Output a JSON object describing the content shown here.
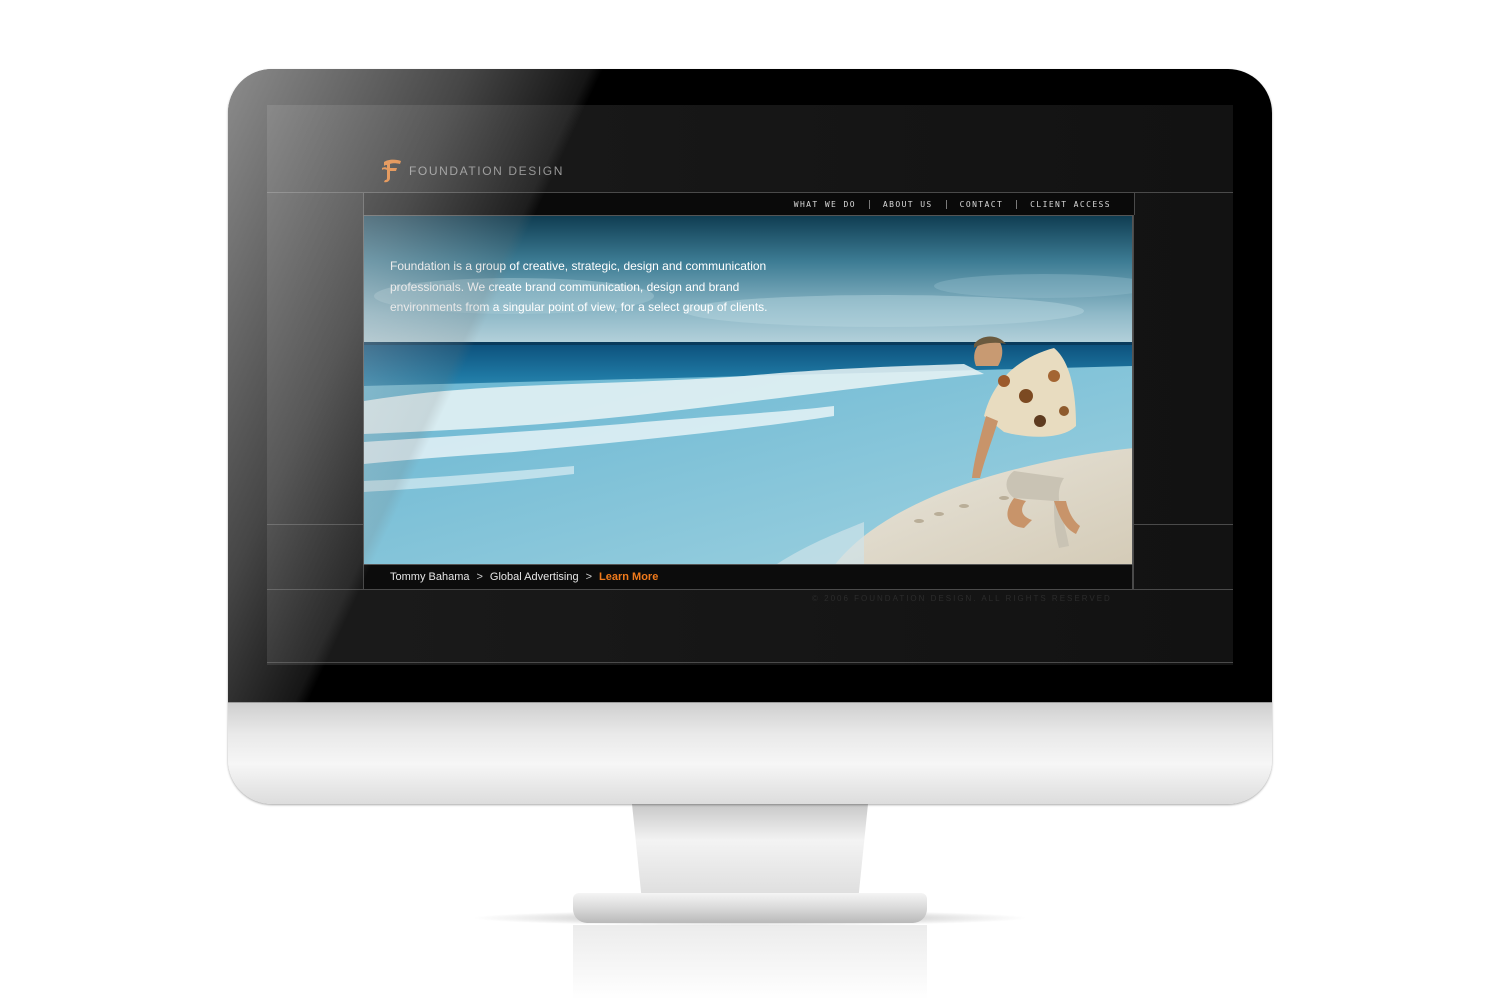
{
  "site": {
    "brand_name": "FOUNDATION DESIGN",
    "accent_color": "#f07a1c",
    "logo_icon": "foundation-f-icon"
  },
  "nav": {
    "items": [
      {
        "label": "WHAT WE DO"
      },
      {
        "label": "ABOUT US"
      },
      {
        "label": "CONTACT"
      },
      {
        "label": "CLIENT ACCESS"
      }
    ]
  },
  "hero": {
    "copy": "Foundation is a group of creative, strategic, design and communication professionals. We create brand communication, design and brand environments from a singular point of view, for a select group of clients."
  },
  "breadcrumb": {
    "client": "Tommy Bahama",
    "category": "Global Advertising",
    "separator": ">",
    "learn_more": "Learn More"
  },
  "footer": {
    "copyright": "© 2006 FOUNDATION DESIGN. ALL RIGHTS RESERVED"
  }
}
